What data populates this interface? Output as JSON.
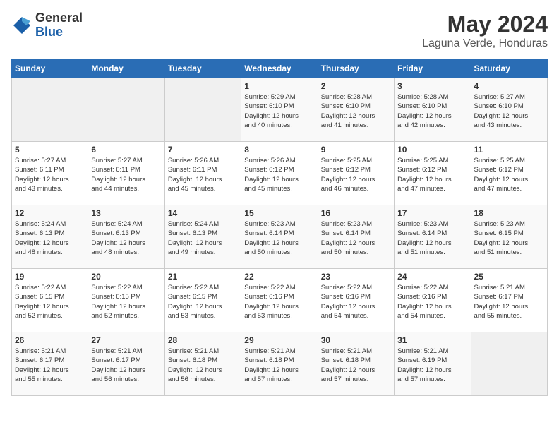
{
  "header": {
    "logo_general": "General",
    "logo_blue": "Blue",
    "month_year": "May 2024",
    "location": "Laguna Verde, Honduras"
  },
  "days_of_week": [
    "Sunday",
    "Monday",
    "Tuesday",
    "Wednesday",
    "Thursday",
    "Friday",
    "Saturday"
  ],
  "weeks": [
    [
      {
        "day": "",
        "info": ""
      },
      {
        "day": "",
        "info": ""
      },
      {
        "day": "",
        "info": ""
      },
      {
        "day": "1",
        "info": "Sunrise: 5:29 AM\nSunset: 6:10 PM\nDaylight: 12 hours\nand 40 minutes."
      },
      {
        "day": "2",
        "info": "Sunrise: 5:28 AM\nSunset: 6:10 PM\nDaylight: 12 hours\nand 41 minutes."
      },
      {
        "day": "3",
        "info": "Sunrise: 5:28 AM\nSunset: 6:10 PM\nDaylight: 12 hours\nand 42 minutes."
      },
      {
        "day": "4",
        "info": "Sunrise: 5:27 AM\nSunset: 6:10 PM\nDaylight: 12 hours\nand 43 minutes."
      }
    ],
    [
      {
        "day": "5",
        "info": "Sunrise: 5:27 AM\nSunset: 6:11 PM\nDaylight: 12 hours\nand 43 minutes."
      },
      {
        "day": "6",
        "info": "Sunrise: 5:27 AM\nSunset: 6:11 PM\nDaylight: 12 hours\nand 44 minutes."
      },
      {
        "day": "7",
        "info": "Sunrise: 5:26 AM\nSunset: 6:11 PM\nDaylight: 12 hours\nand 45 minutes."
      },
      {
        "day": "8",
        "info": "Sunrise: 5:26 AM\nSunset: 6:12 PM\nDaylight: 12 hours\nand 45 minutes."
      },
      {
        "day": "9",
        "info": "Sunrise: 5:25 AM\nSunset: 6:12 PM\nDaylight: 12 hours\nand 46 minutes."
      },
      {
        "day": "10",
        "info": "Sunrise: 5:25 AM\nSunset: 6:12 PM\nDaylight: 12 hours\nand 47 minutes."
      },
      {
        "day": "11",
        "info": "Sunrise: 5:25 AM\nSunset: 6:12 PM\nDaylight: 12 hours\nand 47 minutes."
      }
    ],
    [
      {
        "day": "12",
        "info": "Sunrise: 5:24 AM\nSunset: 6:13 PM\nDaylight: 12 hours\nand 48 minutes."
      },
      {
        "day": "13",
        "info": "Sunrise: 5:24 AM\nSunset: 6:13 PM\nDaylight: 12 hours\nand 48 minutes."
      },
      {
        "day": "14",
        "info": "Sunrise: 5:24 AM\nSunset: 6:13 PM\nDaylight: 12 hours\nand 49 minutes."
      },
      {
        "day": "15",
        "info": "Sunrise: 5:23 AM\nSunset: 6:14 PM\nDaylight: 12 hours\nand 50 minutes."
      },
      {
        "day": "16",
        "info": "Sunrise: 5:23 AM\nSunset: 6:14 PM\nDaylight: 12 hours\nand 50 minutes."
      },
      {
        "day": "17",
        "info": "Sunrise: 5:23 AM\nSunset: 6:14 PM\nDaylight: 12 hours\nand 51 minutes."
      },
      {
        "day": "18",
        "info": "Sunrise: 5:23 AM\nSunset: 6:15 PM\nDaylight: 12 hours\nand 51 minutes."
      }
    ],
    [
      {
        "day": "19",
        "info": "Sunrise: 5:22 AM\nSunset: 6:15 PM\nDaylight: 12 hours\nand 52 minutes."
      },
      {
        "day": "20",
        "info": "Sunrise: 5:22 AM\nSunset: 6:15 PM\nDaylight: 12 hours\nand 52 minutes."
      },
      {
        "day": "21",
        "info": "Sunrise: 5:22 AM\nSunset: 6:15 PM\nDaylight: 12 hours\nand 53 minutes."
      },
      {
        "day": "22",
        "info": "Sunrise: 5:22 AM\nSunset: 6:16 PM\nDaylight: 12 hours\nand 53 minutes."
      },
      {
        "day": "23",
        "info": "Sunrise: 5:22 AM\nSunset: 6:16 PM\nDaylight: 12 hours\nand 54 minutes."
      },
      {
        "day": "24",
        "info": "Sunrise: 5:22 AM\nSunset: 6:16 PM\nDaylight: 12 hours\nand 54 minutes."
      },
      {
        "day": "25",
        "info": "Sunrise: 5:21 AM\nSunset: 6:17 PM\nDaylight: 12 hours\nand 55 minutes."
      }
    ],
    [
      {
        "day": "26",
        "info": "Sunrise: 5:21 AM\nSunset: 6:17 PM\nDaylight: 12 hours\nand 55 minutes."
      },
      {
        "day": "27",
        "info": "Sunrise: 5:21 AM\nSunset: 6:17 PM\nDaylight: 12 hours\nand 56 minutes."
      },
      {
        "day": "28",
        "info": "Sunrise: 5:21 AM\nSunset: 6:18 PM\nDaylight: 12 hours\nand 56 minutes."
      },
      {
        "day": "29",
        "info": "Sunrise: 5:21 AM\nSunset: 6:18 PM\nDaylight: 12 hours\nand 57 minutes."
      },
      {
        "day": "30",
        "info": "Sunrise: 5:21 AM\nSunset: 6:18 PM\nDaylight: 12 hours\nand 57 minutes."
      },
      {
        "day": "31",
        "info": "Sunrise: 5:21 AM\nSunset: 6:19 PM\nDaylight: 12 hours\nand 57 minutes."
      },
      {
        "day": "",
        "info": ""
      }
    ]
  ]
}
